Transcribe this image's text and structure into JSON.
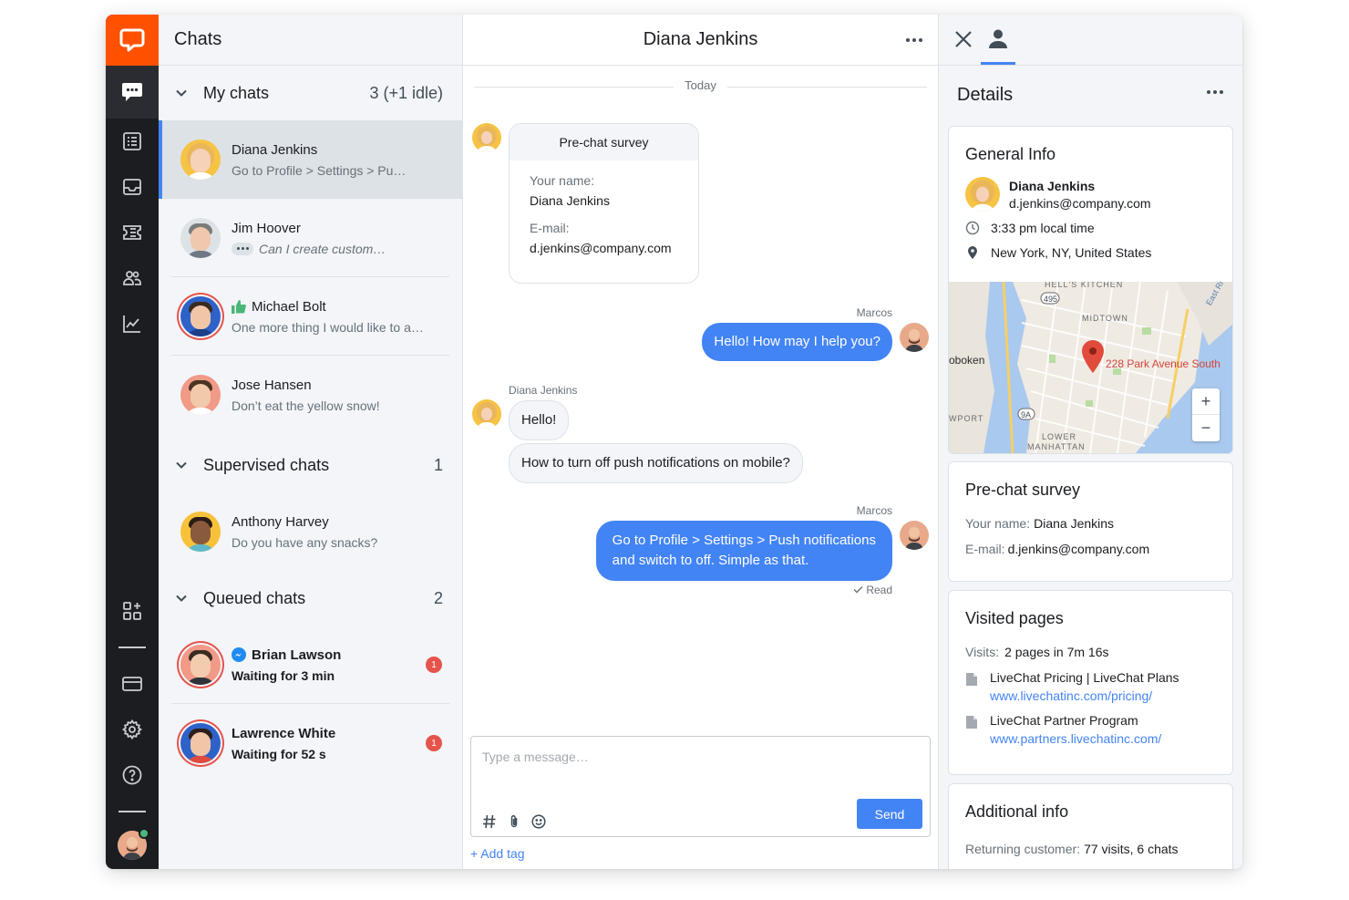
{
  "list": {
    "title": "Chats",
    "groups": [
      {
        "label": "My chats",
        "count": "3 (+1 idle)",
        "chats": [
          {
            "name": "Diana Jenkins",
            "message": "Go to Profile > Settings > Pu…"
          },
          {
            "name": "Jim Hoover",
            "message": "Can I create custom…"
          },
          {
            "name": "Michael Bolt",
            "message": "One more thing I would like to a…"
          },
          {
            "name": "Jose Hansen",
            "message": "Don’t eat the yellow snow!"
          }
        ]
      },
      {
        "label": "Supervised chats",
        "count": "1",
        "chats": [
          {
            "name": "Anthony Harvey",
            "message": "Do you have any snacks?"
          }
        ]
      },
      {
        "label": "Queued chats",
        "count": "2",
        "chats": [
          {
            "name": "Brian Lawson",
            "message": "Waiting for 3 min",
            "badge": "1"
          },
          {
            "name": "Lawrence White",
            "message": "Waiting for 52 s",
            "badge": "1"
          }
        ]
      }
    ]
  },
  "conversation": {
    "title": "Diana Jenkins",
    "day": "Today",
    "survey": {
      "title": "Pre-chat survey",
      "name_label": "Your name:",
      "name_value": "Diana Jenkins",
      "email_label": "E-mail:",
      "email_value": "d.jenkins@company.com"
    },
    "messages": [
      {
        "sender": "Marcos",
        "text": "Hello! How may I help you?"
      },
      {
        "sender": "Diana Jenkins",
        "text": "Hello!"
      },
      {
        "text": "How to turn off push notifications on mobile?"
      },
      {
        "sender": "Marcos",
        "text_line1": "Go to Profile > Settings > Push notifications",
        "text_line2": "and switch to off. Simple as that."
      }
    ],
    "read_status": "Read",
    "composer_placeholder": "Type a message…",
    "send_label": "Send",
    "add_tag": "+ Add tag"
  },
  "details": {
    "title": "Details",
    "general": {
      "title": "General Info",
      "name": "Diana Jenkins",
      "email": "d.jenkins@company.com",
      "local_time": "3:33 pm local time",
      "location": "New York, NY, United States",
      "map_labels": {
        "address": "228 Park Avenue South",
        "hells_kitchen": "HELL'S KITCHEN",
        "midtown": "MIDTOWN",
        "hoboken": "oboken",
        "newport": "WPORT",
        "lower_manhattan_1": "LOWER",
        "lower_manhattan_2": "MANHATTAN",
        "east_river": "East Ri",
        "route_495": "495",
        "route_9a": "9A",
        "zoom_in": "+",
        "zoom_out": "−"
      }
    },
    "survey": {
      "title": "Pre-chat survey",
      "name_label": "Your name:",
      "name_value": "Diana Jenkins",
      "email_label": "E-mail:",
      "email_value": "d.jenkins@company.com"
    },
    "visited": {
      "title": "Visited pages",
      "visits_label": "Visits:",
      "visits_value": "2 pages in 7m 16s",
      "pages": [
        {
          "title": "LiveChat Pricing | LiveChat Plans",
          "url": "www.livechatinc.com/pricing/"
        },
        {
          "title": "LiveChat Partner Program",
          "url": "www.partners.livechatinc.com/"
        }
      ]
    },
    "additional": {
      "title": "Additional info",
      "returning_label": "Returning customer:",
      "returning_value": "77 visits, 6 chats"
    }
  },
  "colors": {
    "brand": "#ff5100",
    "accent": "#4384f5",
    "nav_bg": "#1b1d21",
    "badge": "#e5544b",
    "online": "#4bb678"
  }
}
